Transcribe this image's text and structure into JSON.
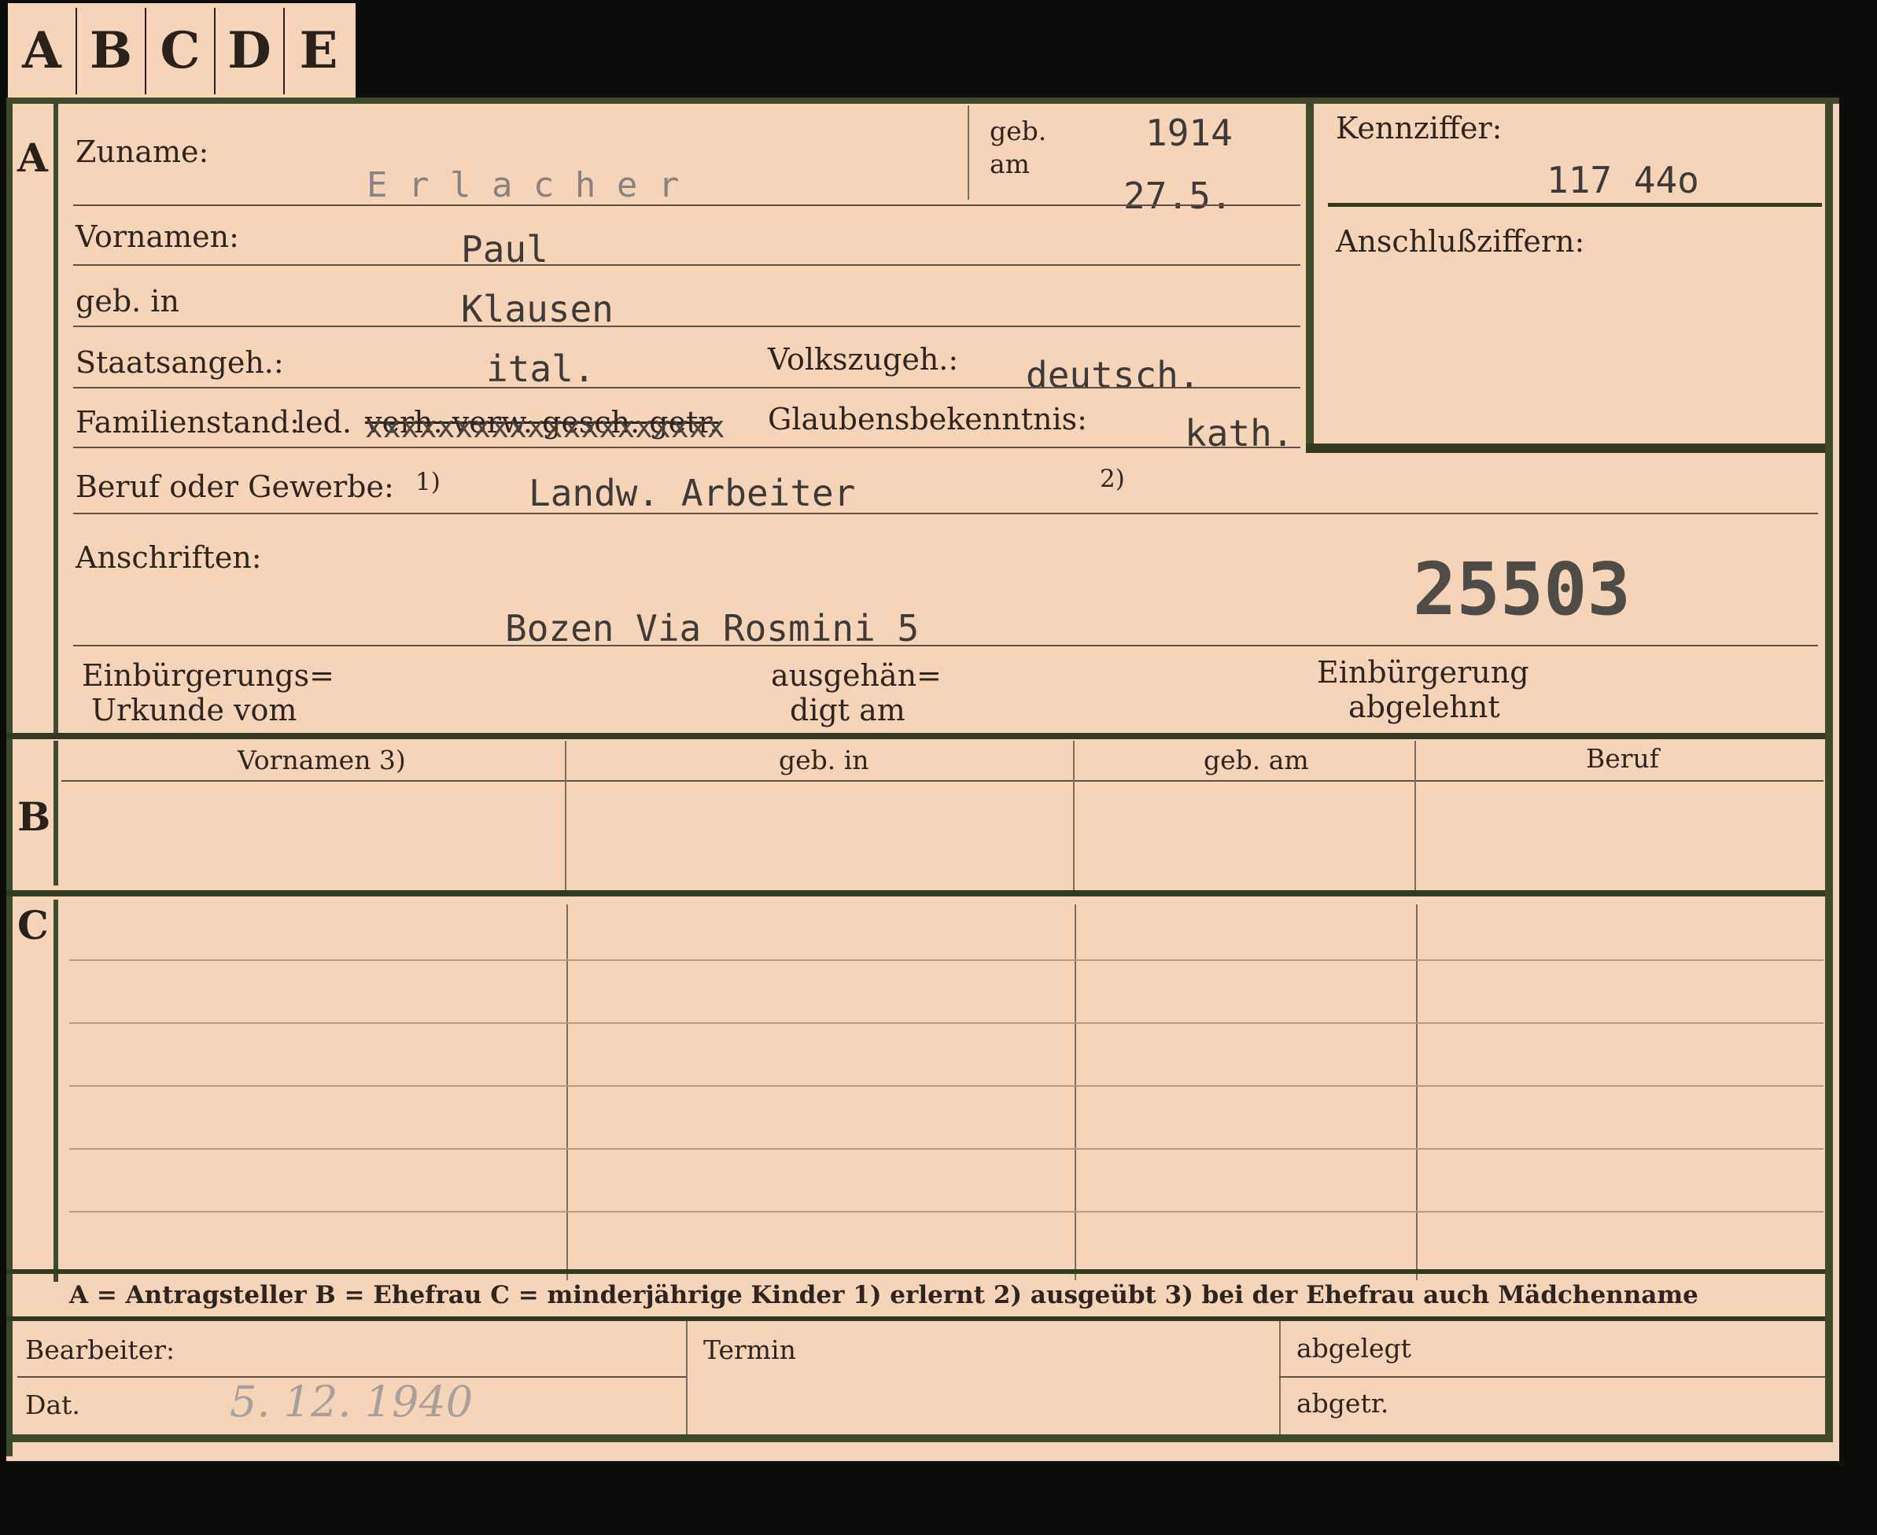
{
  "tabs": [
    "A",
    "B",
    "C",
    "D",
    "E"
  ],
  "section_a": {
    "marker": "A",
    "surname_label": "Zuname:",
    "surname_value": "E r l a c h e r",
    "birth_label_1": "geb.",
    "birth_label_2": "am",
    "birth_year": "1914",
    "birth_date": "27.5.",
    "first_names_label": "Vornamen:",
    "first_names_value": "Paul",
    "birthplace_label": "geb. in",
    "birthplace_value": "Klausen",
    "citizenship_label": "Staatsangeh.:",
    "citizenship_value": "ital.",
    "ethnicity_label": "Volkszugeh.:",
    "ethnicity_value": "deutsch.",
    "marital_label": "Familienstand:",
    "marital_option": "led.",
    "marital_struck": "verh. verw. gesch. getr.",
    "marital_overtype": "xxxxxxxxxxxxxxxxxxxx",
    "religion_label": "Glaubensbekenntnis:",
    "religion_value": "kath.",
    "profession_label": "Beruf oder Gewerbe:",
    "profession_note_1": "1)",
    "profession_value": "Landw. Arbeiter",
    "profession_note_2": "2)",
    "addresses_label": "Anschriften:",
    "address_value": "Bozen Via Rosmini 5",
    "stamp_number": "25503",
    "naturalization_label_1": "Einbürgerungs=",
    "naturalization_label_2": "Urkunde vom",
    "handed_label_1": "ausgehän=",
    "handed_label_2": "digt am",
    "refused_label_1": "Einbürgerung",
    "refused_label_2": "abgelehnt"
  },
  "id_box": {
    "id_label": "Kennziffer:",
    "id_value": "117 44o",
    "link_label": "Anschlußziffern:"
  },
  "section_b": {
    "marker": "B",
    "columns": [
      "Vornamen 3)",
      "geb. in",
      "geb. am",
      "Beruf"
    ]
  },
  "section_c": {
    "marker": "C"
  },
  "legend": {
    "text": "A = Antragsteller   B = Ehefrau   C = minderjährige Kinder   1) erlernt   2) ausgeübt   3) bei der Ehefrau auch Mädchenname"
  },
  "footer": {
    "processor_label": "Bearbeiter:",
    "date_label": "Dat.",
    "date_value": "5. 12. 1940",
    "deadline_label": "Termin",
    "filed_label": "abgelegt",
    "separated_label": "abgetr."
  }
}
